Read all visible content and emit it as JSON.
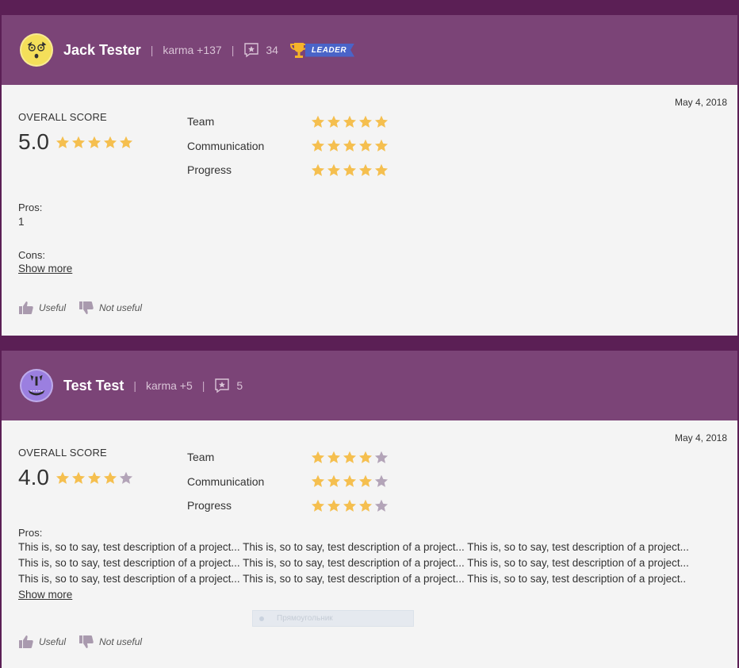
{
  "rating_labels": [
    "Team",
    "Communication",
    "Progress"
  ],
  "colors": {
    "star_filled": "#f5bf4f",
    "star_empty": "#b3a4b8",
    "header_bg": "#7b4477",
    "page_bg": "#5b1f55"
  },
  "reviews": [
    {
      "user": {
        "name": "Jack Tester",
        "karma": "karma +137",
        "reviews_count": "34",
        "badge": "LEADER",
        "avatar_icon": "yellow-face-avatar-icon"
      },
      "date": "May 4, 2018",
      "overall_label": "OVERALL SCORE",
      "overall_score": "5.0",
      "overall_stars": 5,
      "criteria": [
        {
          "name": "Team",
          "stars": 5
        },
        {
          "name": "Communication",
          "stars": 5
        },
        {
          "name": "Progress",
          "stars": 5
        }
      ],
      "pros_label": "Pros:",
      "pros_text": "1",
      "cons_label": "Cons:",
      "show_more": "Show more",
      "useful_label": "Useful",
      "not_useful_label": "Not useful"
    },
    {
      "user": {
        "name": "Test Test",
        "karma": "karma +5",
        "reviews_count": "5",
        "avatar_icon": "purple-face-avatar-icon"
      },
      "date": "May 4, 2018",
      "overall_label": "OVERALL SCORE",
      "overall_score": "4.0",
      "overall_stars": 4,
      "criteria": [
        {
          "name": "Team",
          "stars": 4
        },
        {
          "name": "Communication",
          "stars": 4
        },
        {
          "name": "Progress",
          "stars": 4
        }
      ],
      "pros_label": "Pros:",
      "pros_lines": [
        "This is, so to say, test description of a project... This is, so to say, test description of a project... This is, so to say, test description of a project...",
        "This is, so to say, test description of a project... This is, so to say, test description of a project... This is, so to say, test description of a project...",
        "This is, so to say, test description of a project... This is, so to say, test description of a project... This is, so to say, test description of a project.."
      ],
      "show_more": "Show more",
      "useful_label": "Useful",
      "not_useful_label": "Not useful",
      "overlay_label": "Прямоугольник"
    }
  ]
}
